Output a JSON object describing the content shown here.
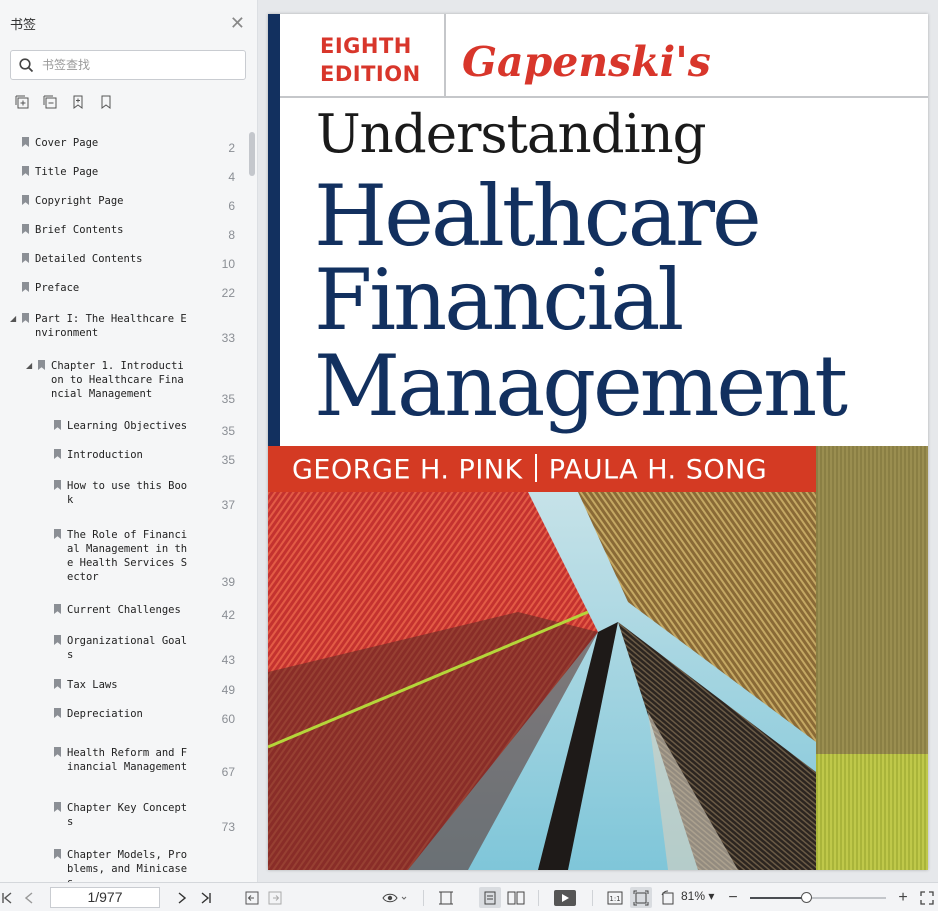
{
  "sidebar": {
    "title": "书签",
    "search_placeholder": "书签查找",
    "bookmarks": [
      {
        "label": "Cover Page",
        "page": "2"
      },
      {
        "label": "Title Page",
        "page": "4"
      },
      {
        "label": "Copyright Page",
        "page": "6"
      },
      {
        "label": "Brief Contents",
        "page": "8"
      },
      {
        "label": "Detailed Contents",
        "page": "10"
      },
      {
        "label": "Preface",
        "page": "22"
      },
      {
        "label": "Part I: The Healthcare E\nnvironment",
        "page": "33"
      },
      {
        "label": "Chapter 1. Introducti\non to Healthcare Fina\nncial Management",
        "page": "35"
      },
      {
        "label": "Learning Objectives",
        "page": "35"
      },
      {
        "label": "Introduction",
        "page": "35"
      },
      {
        "label": "How to use this Boo\nk",
        "page": "37"
      },
      {
        "label": "The Role of Financi\nal Management in th\ne Health Services S\nector",
        "page": "39"
      },
      {
        "label": "Current Challenges",
        "page": "42"
      },
      {
        "label": "Organizational Goal\ns",
        "page": "43"
      },
      {
        "label": "Tax Laws",
        "page": "49"
      },
      {
        "label": "Depreciation",
        "page": "60"
      },
      {
        "label": "Health Reform and F\ninancial Management",
        "page": "67"
      },
      {
        "label": "Chapter Key Concept\ns",
        "page": "73"
      },
      {
        "label": "Chapter Models, Pro\nblems, and Minicase\ns",
        "page": ""
      }
    ]
  },
  "document": {
    "edition_line1": "EIGHTH",
    "edition_line2": "EDITION",
    "author_title": "Gapenski's",
    "title_line1": "Understanding",
    "title_line2": "Healthcare",
    "title_line3": "Financial",
    "title_line4": "Management",
    "author1": "GEORGE H. PINK",
    "author2": "PAULA H. SONG"
  },
  "toolbar": {
    "page_value": "1/977",
    "zoom": "81%"
  },
  "colors": {
    "navy": "#12305f",
    "red": "#d43a23",
    "olive": "#8a7f44",
    "lime": "#a9b43a"
  },
  "zoom_slider_level": 0.42
}
